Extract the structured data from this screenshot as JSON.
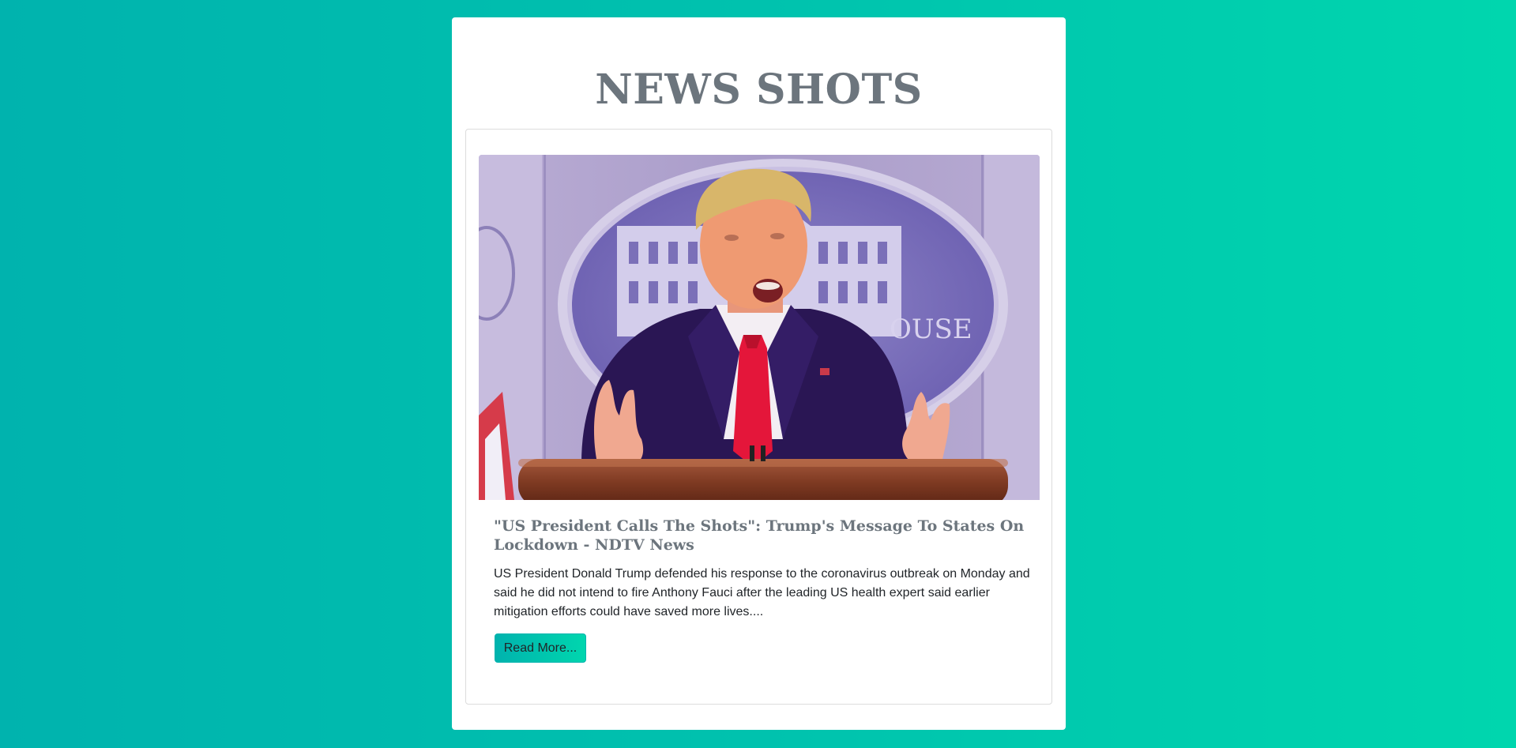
{
  "header": {
    "title": "NEWS SHOTS"
  },
  "article": {
    "image_icon": "press-photo",
    "headline": "\"US President Calls The Shots\": Trump's Message To States On Lockdown - NDTV News",
    "summary": "US President Donald Trump defended his response to the coronavirus outbreak on Monday and said he did not intend to fire Anthony Fauci after the leading US health expert said earlier mitigation efforts could have saved more lives....",
    "read_more_label": "Read More..."
  },
  "colors": {
    "background_start": "#00b3ae",
    "background_end": "#00d6ae",
    "title_color": "#6c757d",
    "text_color": "#212529"
  }
}
